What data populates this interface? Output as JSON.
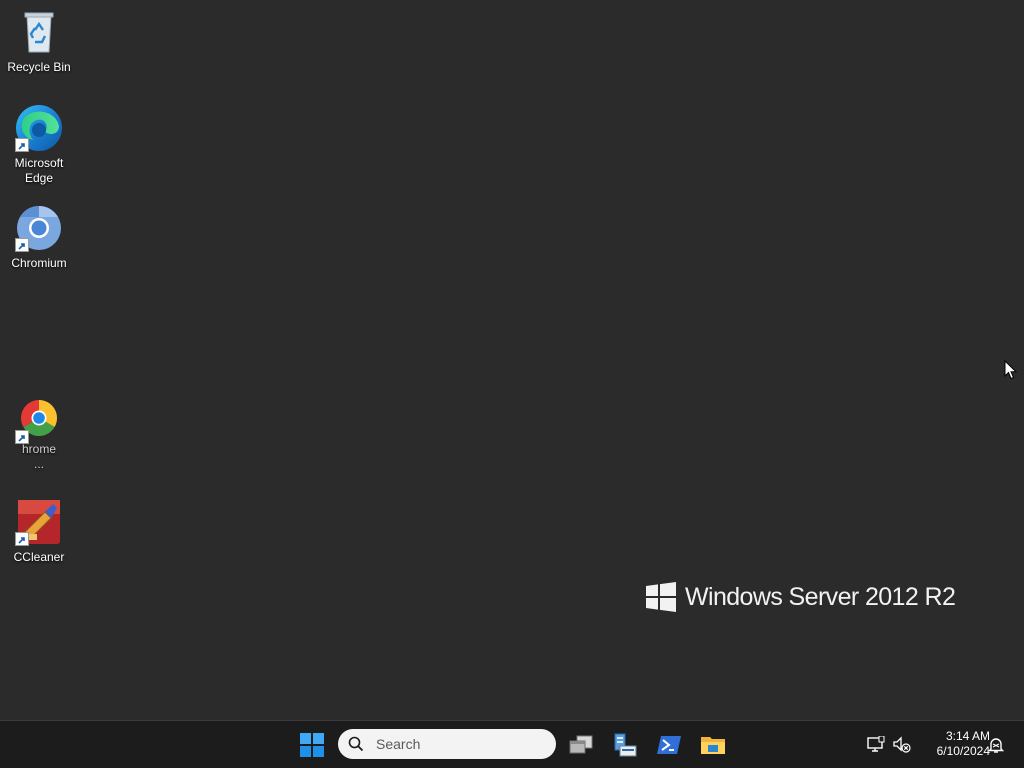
{
  "desktop": {
    "background_color": "#2b2b2b",
    "icons": [
      {
        "label": "Recycle Bin",
        "icon": "recycle-bin-icon"
      },
      {
        "label": "Microsoft\nEdge",
        "icon": "edge-icon"
      },
      {
        "label": "Chromium",
        "icon": "chromium-icon"
      },
      {
        "label": "hrome\n...",
        "icon": "chrome-icon"
      },
      {
        "label": "CCleaner",
        "icon": "ccleaner-icon"
      }
    ],
    "watermark": "Windows Server 2012 R2"
  },
  "taskbar": {
    "search": {
      "placeholder": "Search"
    },
    "pinned": [
      {
        "name": "start",
        "icon": "windows-start-icon"
      },
      {
        "name": "task-view",
        "icon": "task-view-icon"
      },
      {
        "name": "server-manager",
        "icon": "server-manager-icon"
      },
      {
        "name": "powershell",
        "icon": "powershell-icon"
      },
      {
        "name": "file-explorer",
        "icon": "file-explorer-icon"
      }
    ],
    "tray": {
      "network_icon": "network-icon",
      "volume_icon": "volume-muted-icon",
      "time": "3:14 AM",
      "date": "6/10/2024",
      "notification_icon": "notification-icon"
    },
    "accent_color": "#1e90ff"
  }
}
